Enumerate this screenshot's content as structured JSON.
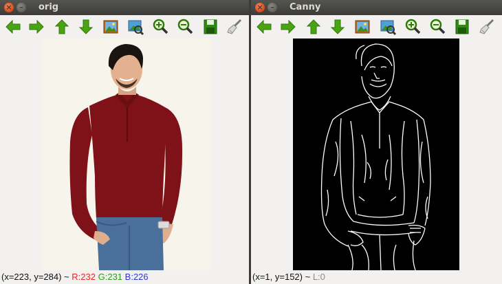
{
  "windows": [
    {
      "title": "orig",
      "status": {
        "coord": "(x=223, y=284) ~",
        "r": "R:232",
        "g": "G:231",
        "b": "B:226"
      }
    },
    {
      "title": "Canny",
      "status": {
        "coord": "(x=1, y=152) ~",
        "l": "L:0"
      }
    }
  ],
  "window_buttons": {
    "close": "×",
    "minimize": "–"
  },
  "toolbar_icons": [
    "arrow-left-icon",
    "arrow-right-icon",
    "arrow-up-icon",
    "arrow-down-icon",
    "image-icon",
    "zoom-fit-icon",
    "zoom-in-icon",
    "zoom-out-icon",
    "save-icon",
    "clear-brush-icon"
  ],
  "colors": {
    "titlebar": "#3c3b37",
    "title_text": "#dfdbd2",
    "close_button": "#dd4814",
    "toolbar_arrow_green": "#4aa312",
    "shirt_maroon": "#7e1218",
    "jeans_blue": "#4a6f9b",
    "photo_background": "#f7f4ec",
    "canny_background": "#000000",
    "status_r": "#e8261b",
    "status_g": "#2e9a1f",
    "status_b": "#2a39d8"
  }
}
